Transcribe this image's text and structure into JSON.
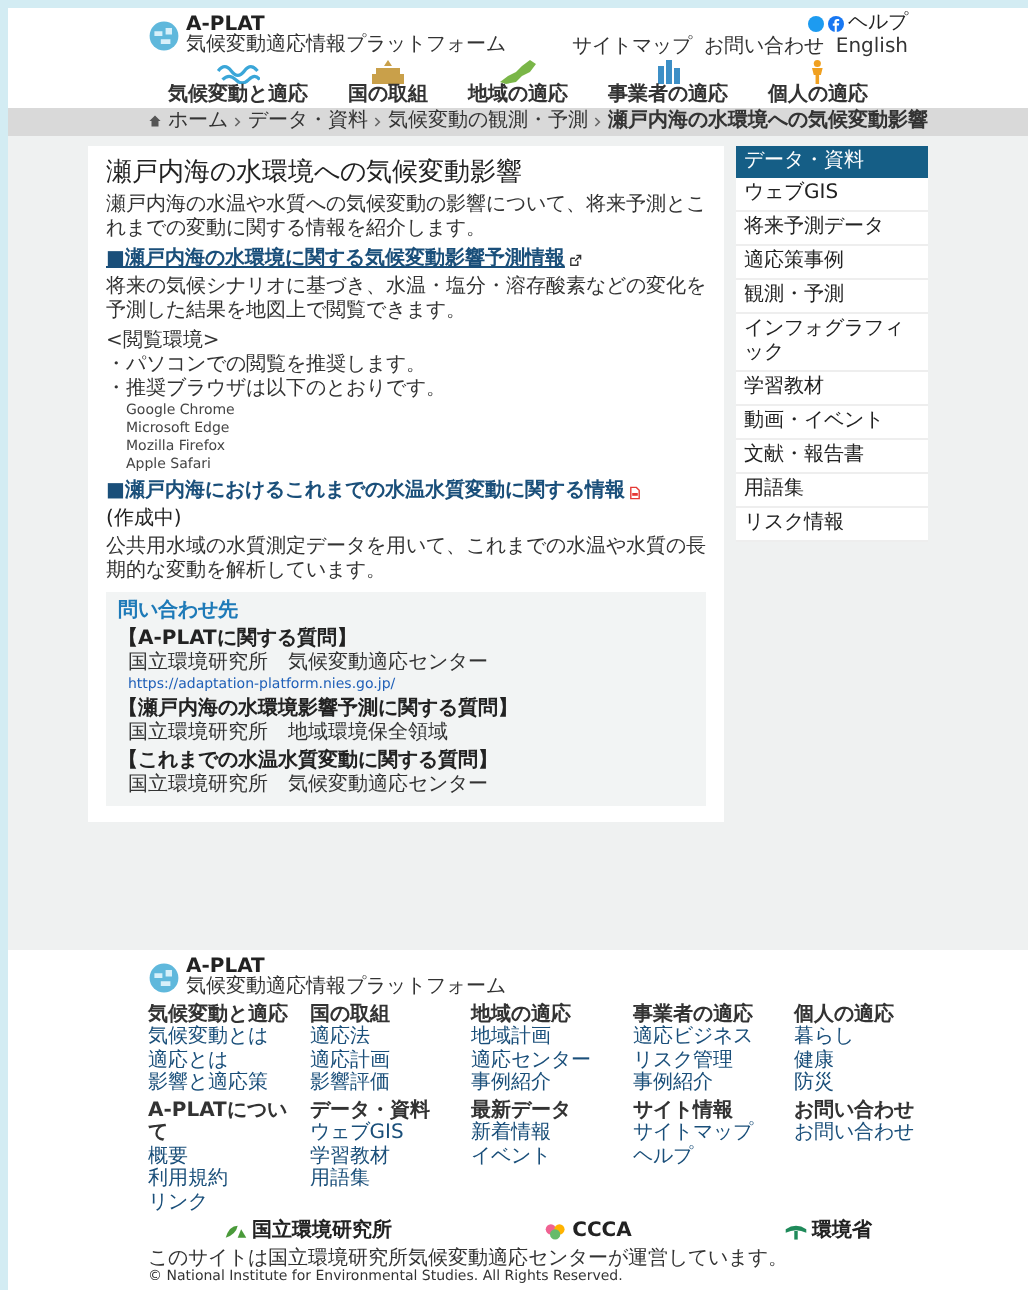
{
  "header": {
    "logo_title": "A-PLAT",
    "logo_subtitle": "気候変動適応情報プラットフォーム",
    "help": "ヘルプ",
    "utility_links": [
      "サイトマップ",
      "お問い合わせ",
      "English"
    ]
  },
  "nav": [
    {
      "label": "気候変動と適応",
      "kind": "wave"
    },
    {
      "label": "国の取組",
      "kind": "building"
    },
    {
      "label": "地域の適応",
      "kind": "map"
    },
    {
      "label": "事業者の適応",
      "kind": "city"
    },
    {
      "label": "個人の適応",
      "kind": "person"
    }
  ],
  "breadcrumb": [
    "ホーム",
    "データ・資料",
    "気候変動の観測・予測",
    "瀬戸内海の水環境への気候変動影響"
  ],
  "article": {
    "title": "瀬戸内海の水環境への気候変動影響",
    "intro": "瀬戸内海の水温や水質への気候変動の影響について、将来予測とこれまでの変動に関する情報を紹介します。",
    "sections": [
      {
        "heading": "■瀬戸内海の水環境に関する気候変動影響予測情報",
        "kind": "external",
        "paragraph": "将来の気候シナリオに基づき、水温・塩分・溶存酸素などの変化を予測した結果を地図上で閲覧できます。",
        "environment": {
          "label": "<閲覧環境>",
          "lines": [
            "・パソコンでの閲覧を推奨します。",
            "・推奨ブラウザは以下のとおりです。"
          ],
          "browsers": [
            "Google Chrome",
            "Microsoft Edge",
            "Mozilla Firefox",
            "Apple Safari"
          ]
        }
      },
      {
        "heading": "■瀬戸内海におけるこれまでの水温水質変動に関する情報",
        "kind": "pdf",
        "note": "(作成中)",
        "paragraph": "公共用水域の水質測定データを用いて、これまでの水温や水質の長期的な変動を解析しています。"
      }
    ],
    "contact": {
      "title": "問い合わせ先",
      "groups": [
        {
          "label": "【A-PLATに関する質問】",
          "lines": [
            {
              "text": "国立環境研究所　気候変動適応センター",
              "kind": "text"
            },
            {
              "text": "https://adaptation-platform.nies.go.jp/",
              "kind": "link"
            }
          ]
        },
        {
          "label": "【瀬戸内海の水環境影響予測に関する質問】",
          "lines": [
            {
              "text": "国立環境研究所　地域環境保全領域",
              "kind": "text"
            }
          ]
        },
        {
          "label": "【これまでの水温水質変動に関する質問】",
          "lines": [
            {
              "text": "国立環境研究所　気候変動適応センター",
              "kind": "text"
            }
          ]
        }
      ]
    }
  },
  "sidebar": {
    "title": "データ・資料",
    "items": [
      "ウェブGIS",
      "将来予測データ",
      "適応策事例",
      "観測・予測",
      "インフォグラフィック",
      "学習教材",
      "動画・イベント",
      "文献・報告書",
      "用語集",
      "リスク情報"
    ]
  },
  "footer": {
    "logo_title": "A-PLAT",
    "logo_subtitle": "気候変動適応情報プラットフォーム",
    "columns": [
      {
        "heading": "気候変動と適応",
        "links": [
          "気候変動とは",
          "適応とは",
          "影響と適応策"
        ]
      },
      {
        "heading": "国の取組",
        "links": [
          "適応法",
          "適応計画",
          "影響評価"
        ]
      },
      {
        "heading": "地域の適応",
        "links": [
          "地域計画",
          "適応センター",
          "事例紹介"
        ]
      },
      {
        "heading": "事業者の適応",
        "links": [
          "適応ビジネス",
          "リスク管理",
          "事例紹介"
        ]
      },
      {
        "heading": "個人の適応",
        "links": [
          "暮らし",
          "健康",
          "防災"
        ]
      },
      {
        "heading": "A-PLATについて",
        "links": [
          "概要",
          "利用規約",
          "リンク"
        ]
      },
      {
        "heading": "データ・資料",
        "links": [
          "ウェブGIS",
          "学習教材",
          "用語集"
        ]
      },
      {
        "heading": "最新データ",
        "links": [
          "新着情報",
          "イベント"
        ]
      },
      {
        "heading": "サイト情報",
        "links": [
          "サイトマップ",
          "ヘルプ"
        ]
      },
      {
        "heading": "お問い合わせ",
        "links": [
          "お問い合わせ"
        ]
      }
    ],
    "partners": [
      {
        "name": "国立環境研究所",
        "kind": "nies"
      },
      {
        "name": "CCCA",
        "kind": "ccca"
      },
      {
        "name": "環境省",
        "kind": "moe"
      }
    ],
    "credits": [
      "このサイトは国立環境研究所気候変動適応センターが運営しています。",
      "© National Institute for Environmental Studies. All Rights Reserved."
    ]
  }
}
